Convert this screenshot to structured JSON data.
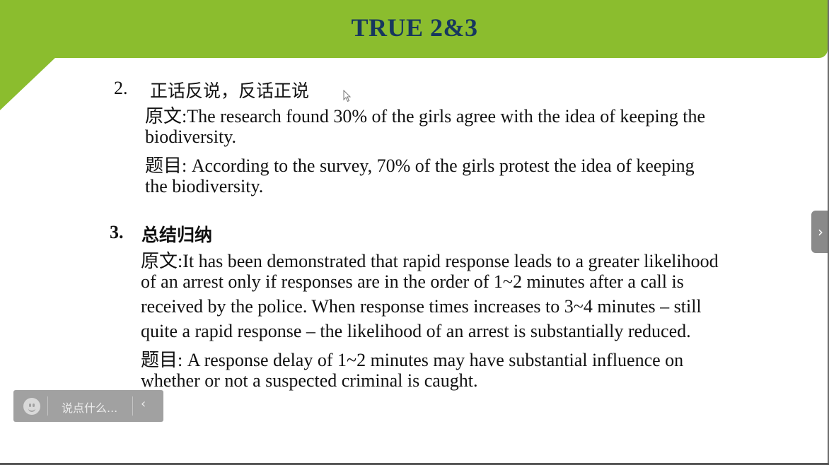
{
  "slide": {
    "title": "TRUE 2&3"
  },
  "item2": {
    "number": "2.",
    "heading": "正话反说，反话正说",
    "lines": [
      "原文:The research found 30% of the girls agree with the idea of keeping the",
      "biodiversity.",
      "题目: According to the survey, 70% of the girls protest the idea of keeping",
      "the biodiversity."
    ]
  },
  "item3": {
    "number": "3.",
    "heading": "总结归纳",
    "lines": [
      "原文:It has been demonstrated that rapid response leads to a greater likelihood",
      "of an arrest only if responses are in the order of 1~2 minutes after a call is",
      "received by the police. When response times increases to 3~4 minutes – still",
      "quite a rapid response – the likelihood of an arrest is substantially reduced.",
      "题目: A response delay of 1~2 minutes may have substantial influence on",
      "whether or not a suspected criminal is caught."
    ]
  },
  "chat": {
    "placeholder": "说点什么...",
    "collapse_icon": "‹",
    "emoji_icon": "smiley-icon"
  },
  "nav": {
    "next_icon": "›"
  },
  "colors": {
    "title_bar": "#8bbd2e",
    "title_text": "#17375e"
  }
}
